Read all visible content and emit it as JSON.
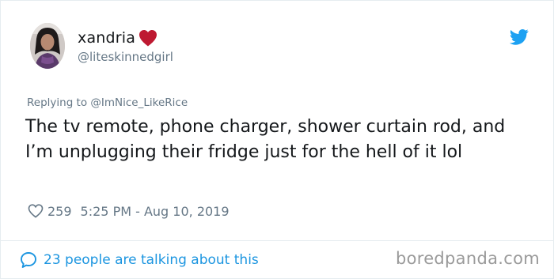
{
  "user": {
    "display_name": "xandria",
    "username": "@liteskinnedgirl"
  },
  "tweet": {
    "replying_to": "Replying to @ImNice_LikeRice",
    "text": "The tv remote, phone charger, shower curtain rod, and I’m unplugging their fridge just for the hell of it lol",
    "likes": "259",
    "timestamp": "5:25 PM - Aug 10, 2019"
  },
  "footer": {
    "conversation_label": "23 people are talking about this",
    "watermark": "boredpanda.com"
  },
  "icons": {
    "avatar": "profile-photo",
    "name_emoji": "red-heart-icon",
    "brand": "twitter-bird-icon",
    "like": "heart-outline-icon",
    "conversation": "speech-bubble-icon"
  },
  "colors": {
    "link_blue": "#1b95e0",
    "twitter_blue": "#1da1f2",
    "heart_red": "#be1931",
    "muted_text": "#657786",
    "watermark_gray": "#9a9a9a"
  }
}
